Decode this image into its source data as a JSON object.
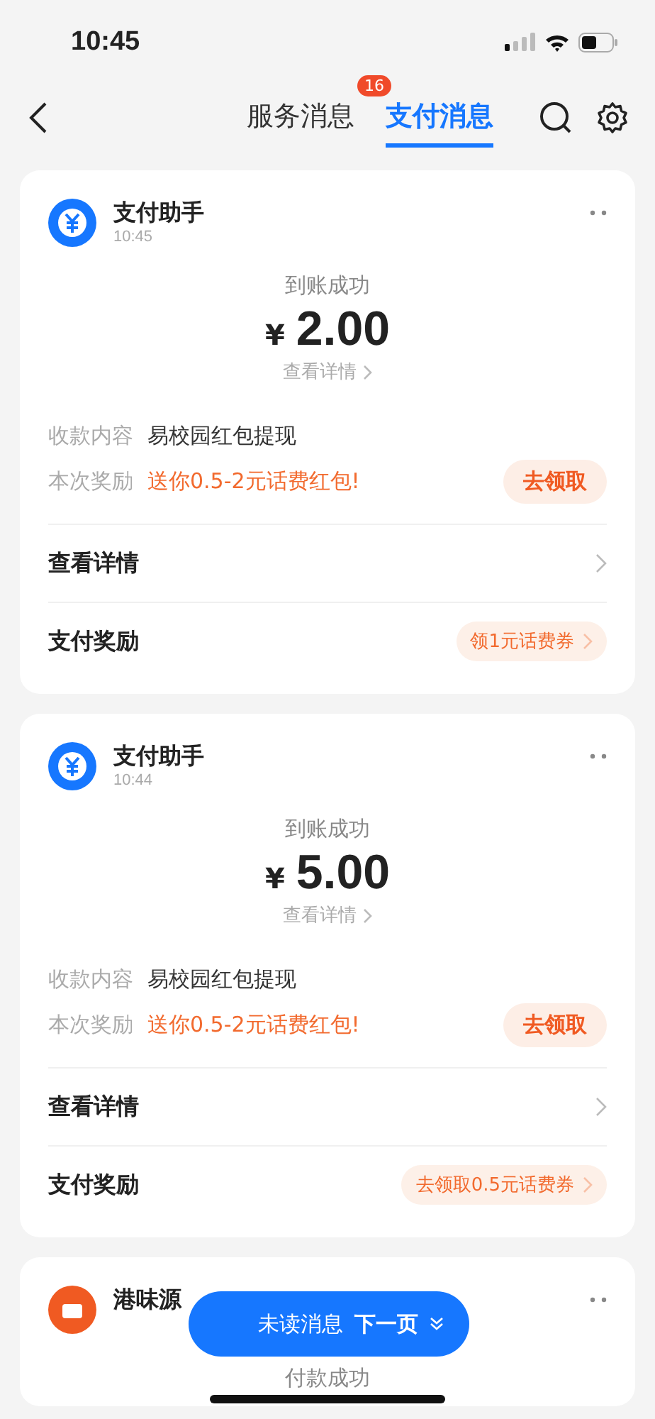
{
  "status_bar": {
    "time": "10:45"
  },
  "header": {
    "tabs": [
      {
        "label": "服务消息",
        "selected": false,
        "badge": "16"
      },
      {
        "label": "支付消息",
        "selected": true
      }
    ]
  },
  "messages": [
    {
      "sender": "支付助手",
      "time": "10:45",
      "kind": "payment",
      "status": "到账成功",
      "currency": "¥",
      "amount": "2.00",
      "detail_link": "查看详情",
      "info": [
        {
          "label": "收款内容",
          "value": "易校园红包提现",
          "kind": "plain"
        },
        {
          "label": "本次奖励",
          "value": "送你0.5-2元话费红包!",
          "kind": "promo",
          "action": "去领取"
        }
      ],
      "rows": [
        {
          "label": "查看详情"
        },
        {
          "label": "支付奖励",
          "tag": "领1元话费券"
        }
      ]
    },
    {
      "sender": "支付助手",
      "time": "10:44",
      "kind": "payment",
      "status": "到账成功",
      "currency": "¥",
      "amount": "5.00",
      "detail_link": "查看详情",
      "info": [
        {
          "label": "收款内容",
          "value": "易校园红包提现",
          "kind": "plain"
        },
        {
          "label": "本次奖励",
          "value": "送你0.5-2元话费红包!",
          "kind": "promo",
          "action": "去领取"
        }
      ],
      "rows": [
        {
          "label": "查看详情"
        },
        {
          "label": "支付奖励",
          "tag": "去领取0.5元话费券"
        }
      ]
    },
    {
      "sender": "港味源",
      "kind": "merchant",
      "status": "付款成功"
    }
  ],
  "floating_button": {
    "label": "未读消息",
    "action": "下一页"
  }
}
